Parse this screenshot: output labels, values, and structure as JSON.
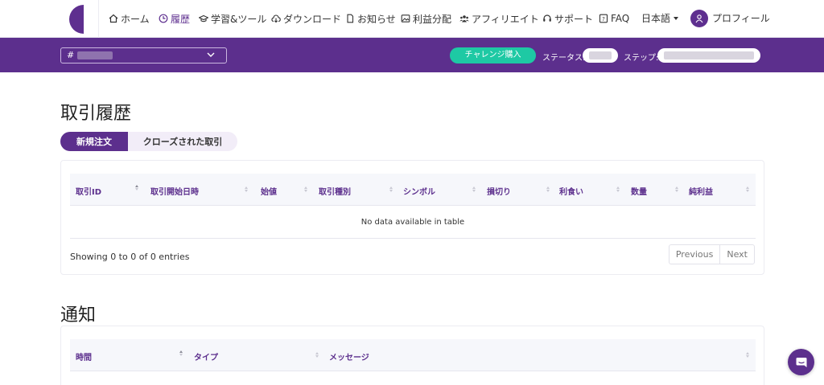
{
  "nav": {
    "items": [
      {
        "label": "ホーム",
        "icon": "home-icon"
      },
      {
        "label": "履歴",
        "icon": "clock-icon",
        "active": true
      },
      {
        "label": "学習&ツール",
        "icon": "graduation-cap-icon"
      },
      {
        "label": "ダウンロード",
        "icon": "cloud-download-icon"
      },
      {
        "label": "お知らせ",
        "icon": "document-icon"
      },
      {
        "label": "利益分配",
        "icon": "image-icon"
      },
      {
        "label": "アフィリエイト",
        "icon": "users-icon"
      },
      {
        "label": "サポート",
        "icon": "headset-icon"
      },
      {
        "label": "FAQ",
        "icon": "question-icon"
      }
    ],
    "language": "日本語",
    "profile": "プロフィール"
  },
  "bar": {
    "account_prefix": "#",
    "challenge_button": "チャレンジ購入",
    "status_label": "ステータス:",
    "step_label": "ステップ:"
  },
  "trades": {
    "title": "取引履歴",
    "tabs": [
      "新規注文",
      "クローズされた取引"
    ],
    "columns": [
      "取引ID",
      "取引開始日時",
      "始値",
      "取引種別",
      "シンボル",
      "損切り",
      "利食い",
      "数量",
      "純利益"
    ],
    "empty": "No data available in table",
    "info": "Showing 0 to 0 of 0 entries",
    "prev": "Previous",
    "next": "Next"
  },
  "notices": {
    "title": "通知",
    "columns": [
      "時間",
      "タイプ",
      "メッセージ"
    ]
  },
  "colors": {
    "brand": "#5c2f8d",
    "accent": "#1ec9a4"
  }
}
